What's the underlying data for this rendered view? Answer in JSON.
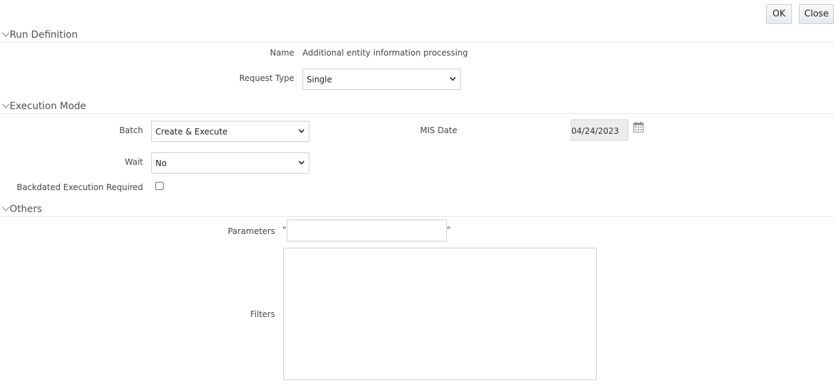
{
  "toolbar": {
    "ok_label": "OK",
    "close_label": "Close"
  },
  "sections": {
    "run_definition": "Run Definition",
    "execution_mode": "Execution Mode",
    "others": "Others"
  },
  "run_definition": {
    "name_label": "Name",
    "name_value": "Additional entity information processing",
    "request_type_label": "Request Type",
    "request_type_value": "Single"
  },
  "execution_mode": {
    "batch_label": "Batch",
    "batch_value": "Create & Execute",
    "mis_date_label": "MIS Date",
    "mis_date_value": "04/24/2023",
    "wait_label": "Wait",
    "wait_value": "No",
    "backdated_label": "Backdated Execution Required",
    "backdated_checked": false
  },
  "others": {
    "parameters_label": "Parameters",
    "quote_open": "\"",
    "quote_close": "\"",
    "parameters_value": "",
    "filters_label": "Filters",
    "filters_value": ""
  },
  "icons": {
    "section_toggle": "chevron-down-icon",
    "select_arrow": "chevron-down-icon",
    "date_picker": "calendar-icon"
  },
  "colors": {
    "label": "#444444",
    "section_title": "#4f4f4f",
    "disabled_bg": "#ececec"
  }
}
